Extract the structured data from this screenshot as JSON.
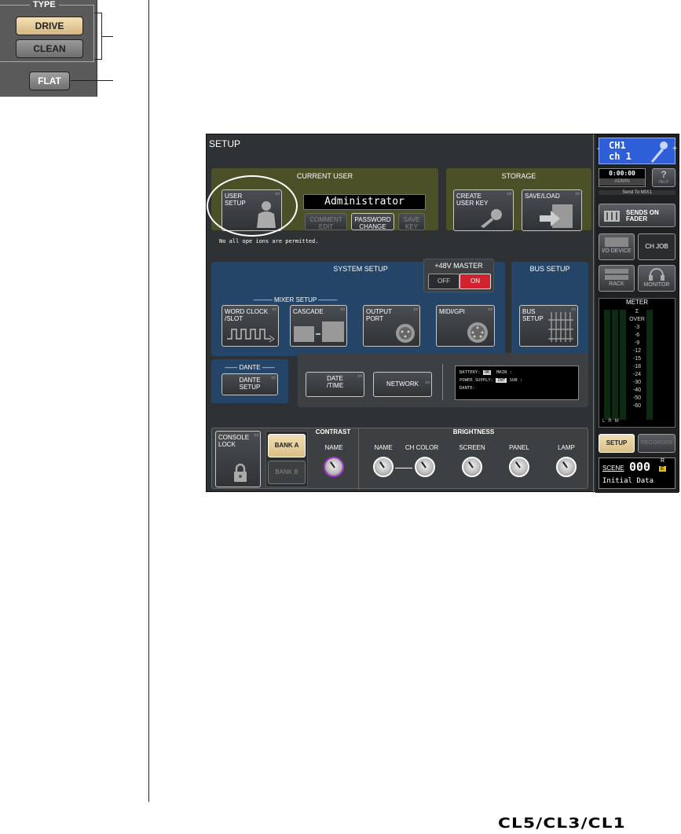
{
  "fragment": {
    "type_label": "TYPE",
    "drive_label": "DRIVE",
    "clean_label": "CLEAN",
    "flat_label": "FLAT"
  },
  "screen": {
    "title": "SETUP",
    "current_user": {
      "title": "CURRENT USER",
      "user_setup_label": "USER SETUP",
      "user_name": "Administrator",
      "comment_edit_label": "COMMENT EDIT",
      "password_change_label": "PASSWORD CHANGE",
      "save_key_label": "SAVE KEY",
      "permission_text": "No  all ope   ions are permitted."
    },
    "storage": {
      "title": "STORAGE",
      "create_user_key_label": "CREATE USER KEY",
      "save_load_label": "SAVE/LOAD"
    },
    "system_setup": {
      "title": "SYSTEM SETUP",
      "phantom_title": "+48V MASTER",
      "off_label": "OFF",
      "on_label": "ON",
      "mixer_setup_label": "MIXER SETUP",
      "word_clock_label": "WORD CLOCK /SLOT",
      "cascade_label": "CASCADE",
      "output_port_label": "OUTPUT PORT",
      "midi_gpi_label": "MIDI/GPI"
    },
    "bus_setup": {
      "title": "BUS SETUP",
      "bus_setup_button_label": "BUS SETUP"
    },
    "dante": {
      "title": "DANTE",
      "dante_setup_label": "DANTE SETUP"
    },
    "misc": {
      "date_time_label": "DATE /TIME",
      "network_label": "NETWORK",
      "battery_label": "BATTERY:",
      "battery_status": "OK",
      "main_label": "MAIN :",
      "power_supply_label": "POWER SUPPLY:",
      "power_supply_status": "INT",
      "sub_label": "SUB  :",
      "dante_status_label": "DANTE:"
    },
    "bottom": {
      "console_lock_label": "CONSOLE LOCK",
      "bank_a_label": "BANK A",
      "bank_b_label": "BANK B",
      "contrast_title": "CONTRAST",
      "contrast_name_label": "NAME",
      "brightness_title": "BRIGHTNESS",
      "brightness_knobs": [
        "NAME",
        "CH COLOR",
        "SCREEN",
        "PANEL",
        "LAMP"
      ]
    },
    "sidebar": {
      "channel_short": "CH1",
      "channel_name": "ch 1",
      "time": "0:00:00",
      "user": "ADMIN",
      "help_label": "HELP",
      "send_to_label": "Send To MIX1",
      "sends_on_fader_label": "SENDS ON FADER",
      "io_device_label": "I/O DEVICE",
      "ch_job_label": "CH JOB",
      "rack_label": "RACK",
      "monitor_label": "MONITOR",
      "meter_title": "METER",
      "meter_scale": [
        "Σ",
        "OVER",
        "-3",
        "-6",
        "-9",
        "-12",
        "-15",
        "-18",
        "-24",
        "-30",
        "-40",
        "-50",
        "-60"
      ],
      "meter_channels": [
        "L",
        "R",
        "M"
      ],
      "setup_label": "SETUP",
      "recorder_label": "RECORDER",
      "scene_label": "SCENE",
      "scene_number": "000",
      "scene_r": "R",
      "scene_e": "E",
      "scene_name": "Initial Data"
    }
  },
  "footer": {
    "logo_text": "CL5/CL3/CL1"
  },
  "colors": {
    "olive_panel": "#4b5026",
    "blue_panel": "#244567",
    "on_red": "#d1232f",
    "drive_tan": "#e6cc9a",
    "bank_a_tan": "#e8d4a4",
    "channel_blue": "#2f5fd8",
    "contrast_knob_purple": "#a236c8"
  }
}
